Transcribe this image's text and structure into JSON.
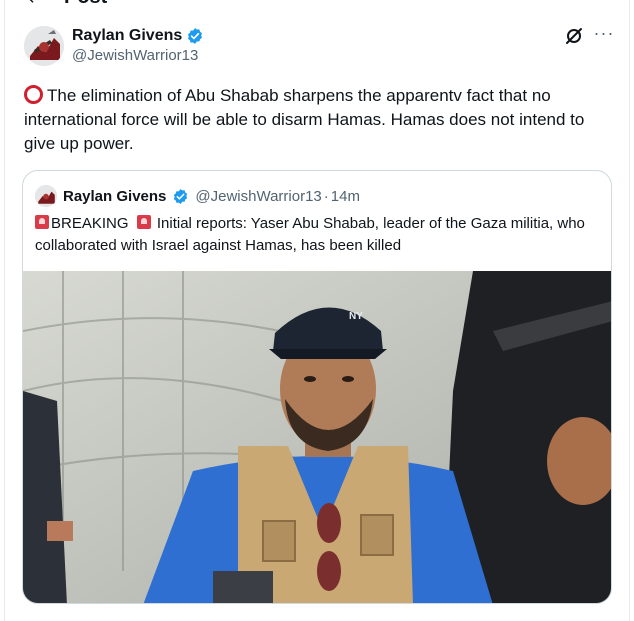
{
  "page": {
    "title": "Post"
  },
  "post": {
    "author": {
      "display_name": "Raylan Givens",
      "handle": "@JewishWarrior13",
      "verified": true
    },
    "text": "The elimination of Abu Shabab sharpens the apparentv fact that no international force will be able to disarm Hamas. Hamas does not intend to give up power.",
    "leading_emoji": "red-hollow-circle",
    "actions": {
      "more_label": "···"
    }
  },
  "quoted_post": {
    "author": {
      "display_name": "Raylan Givens",
      "handle": "@JewishWarrior13",
      "separator": "·",
      "time": "14m",
      "verified": true
    },
    "breaking_label": "BREAKING",
    "text": "Initial reports: Yaser Abu Shabab, leader of the Gaza militia, who collaborated with Israel against Hamas, has been killed",
    "emoji": "police-car-light",
    "media": {
      "type": "photo",
      "cap_logo": "NY"
    }
  },
  "colors": {
    "verified_blue": "#1d9bf0",
    "text_primary": "#0f1419",
    "text_secondary": "#536471",
    "border": "#cfd9de",
    "emoji_red": "#d0202e"
  }
}
